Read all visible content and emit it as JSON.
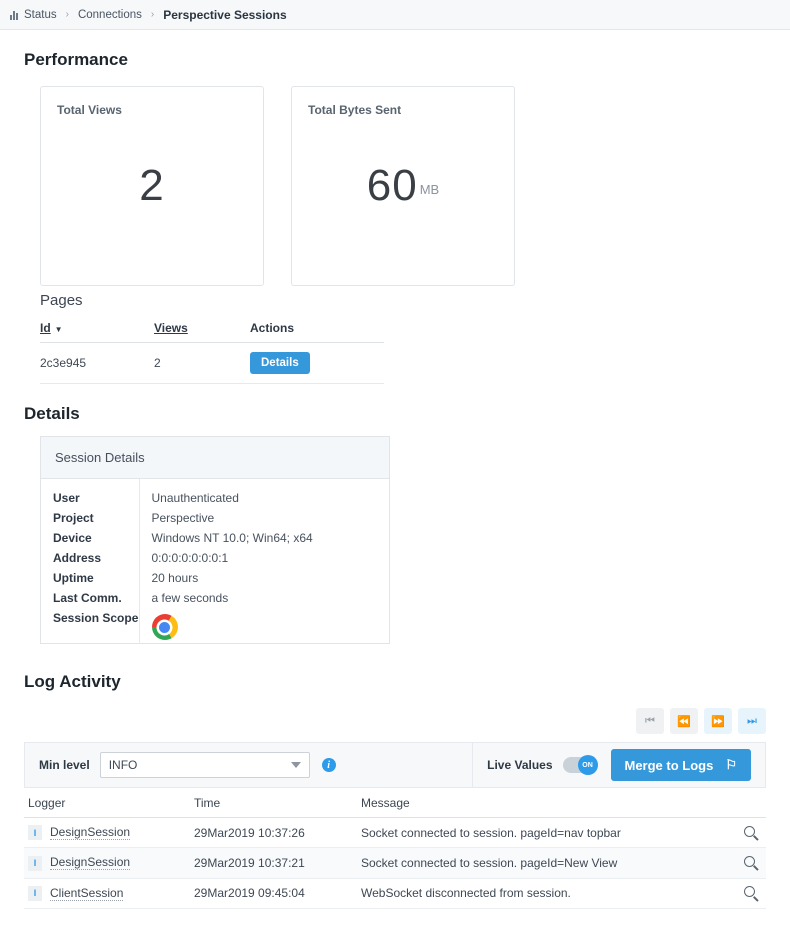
{
  "breadcrumb": {
    "icon": "bar-chart-icon",
    "items": [
      "Status",
      "Connections"
    ],
    "current": "Perspective Sessions",
    "separator": "›"
  },
  "performance": {
    "heading": "Performance",
    "cards": [
      {
        "title": "Total Views",
        "value": "2",
        "unit": ""
      },
      {
        "title": "Total Bytes Sent",
        "value": "60",
        "unit": "MB"
      }
    ]
  },
  "pages": {
    "heading": "Pages",
    "columns": [
      "Id",
      "Views",
      "Actions"
    ],
    "sort_caret": "▼",
    "rows": [
      {
        "id": "2c3e945",
        "views": "2",
        "action_label": "Details"
      }
    ]
  },
  "details": {
    "heading": "Details",
    "panel_title": "Session Details",
    "fields": [
      {
        "label": "User",
        "value": "Unauthenticated"
      },
      {
        "label": "Project",
        "value": "Perspective"
      },
      {
        "label": "Device",
        "value": "Windows NT 10.0; Win64; x64"
      },
      {
        "label": "Address",
        "value": "0:0:0:0:0:0:0:1"
      },
      {
        "label": "Uptime",
        "value": "20 hours"
      },
      {
        "label": "Last Comm.",
        "value": "a few seconds"
      },
      {
        "label": "Session Scope",
        "value": ""
      }
    ],
    "session_scope_icon": "chrome-logo-icon"
  },
  "log_activity": {
    "heading": "Log Activity",
    "pager": [
      {
        "name": "first-page",
        "glyph": "⏮",
        "enabled": false
      },
      {
        "name": "previous-page",
        "glyph": "⏪",
        "enabled": false
      },
      {
        "name": "next-page",
        "glyph": "⏩",
        "enabled": true
      },
      {
        "name": "last-page",
        "glyph": "⏭",
        "enabled": true
      }
    ],
    "filter": {
      "min_level_label": "Min level",
      "min_level_value": "INFO",
      "info_icon": "info-icon",
      "live_values_label": "Live Values",
      "live_values_state": "ON",
      "merge_button_label": "Merge to Logs",
      "merge_button_icon": "flag-icon"
    },
    "columns": [
      "Logger",
      "Time",
      "Message"
    ],
    "rows": [
      {
        "level": "I",
        "logger": "DesignSession",
        "time": "29Mar2019 10:37:26",
        "message": "Socket connected to session. pageId=nav topbar"
      },
      {
        "level": "I",
        "logger": "DesignSession",
        "time": "29Mar2019 10:37:21",
        "message": "Socket connected to session. pageId=New View"
      },
      {
        "level": "I",
        "logger": "ClientSession",
        "time": "29Mar2019 09:45:04",
        "message": "WebSocket disconnected from session."
      }
    ]
  },
  "colors": {
    "accent": "#3498db",
    "info": "#2e9bea",
    "bar_bg": "#f6f8fa"
  }
}
